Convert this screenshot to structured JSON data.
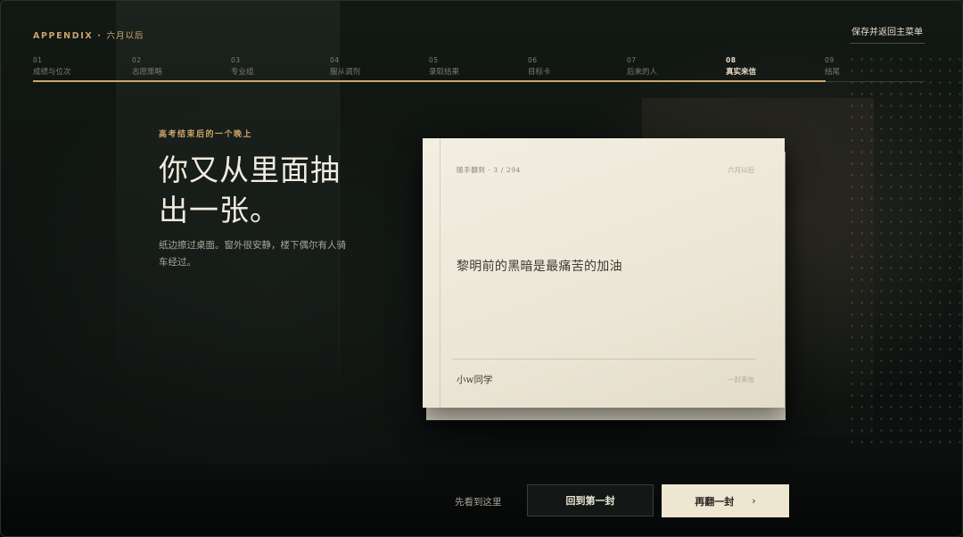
{
  "header": {
    "appendix": "APPENDIX",
    "separator": "·",
    "subtitle": "六月以后",
    "save_label": "保存并返回主菜单"
  },
  "steps": [
    {
      "num": "01",
      "label": "成绩与位次"
    },
    {
      "num": "02",
      "label": "志愿策略"
    },
    {
      "num": "03",
      "label": "专业组"
    },
    {
      "num": "04",
      "label": "服从调剂"
    },
    {
      "num": "05",
      "label": "录取结果"
    },
    {
      "num": "06",
      "label": "目标卡"
    },
    {
      "num": "07",
      "label": "后来的人"
    },
    {
      "num": "08",
      "label": "真实来信",
      "active": true
    },
    {
      "num": "09",
      "label": "结尾"
    }
  ],
  "intro": {
    "kicker": "高考结束后的一个晚上",
    "headline_line1": "你又从里面抽",
    "headline_line2": "出一张。",
    "body": "纸边擦过桌面。窗外很安静，楼下偶尔有人骑车经过。"
  },
  "card": {
    "meta": "随手翻到 · 3 / 294",
    "date": "六月以后",
    "message": "黎明前的黑暗是最痛苦的加油",
    "sender": "小w同学",
    "tag": "一封来信"
  },
  "actions": {
    "stop_label": "先看到这里",
    "first_label": "回到第一封",
    "next_label": "再翻一封",
    "next_chevron": "›"
  },
  "colors": {
    "accent_gold": "#c9a76c",
    "card_paper": "#efe8d8",
    "background": "#0e1310"
  }
}
